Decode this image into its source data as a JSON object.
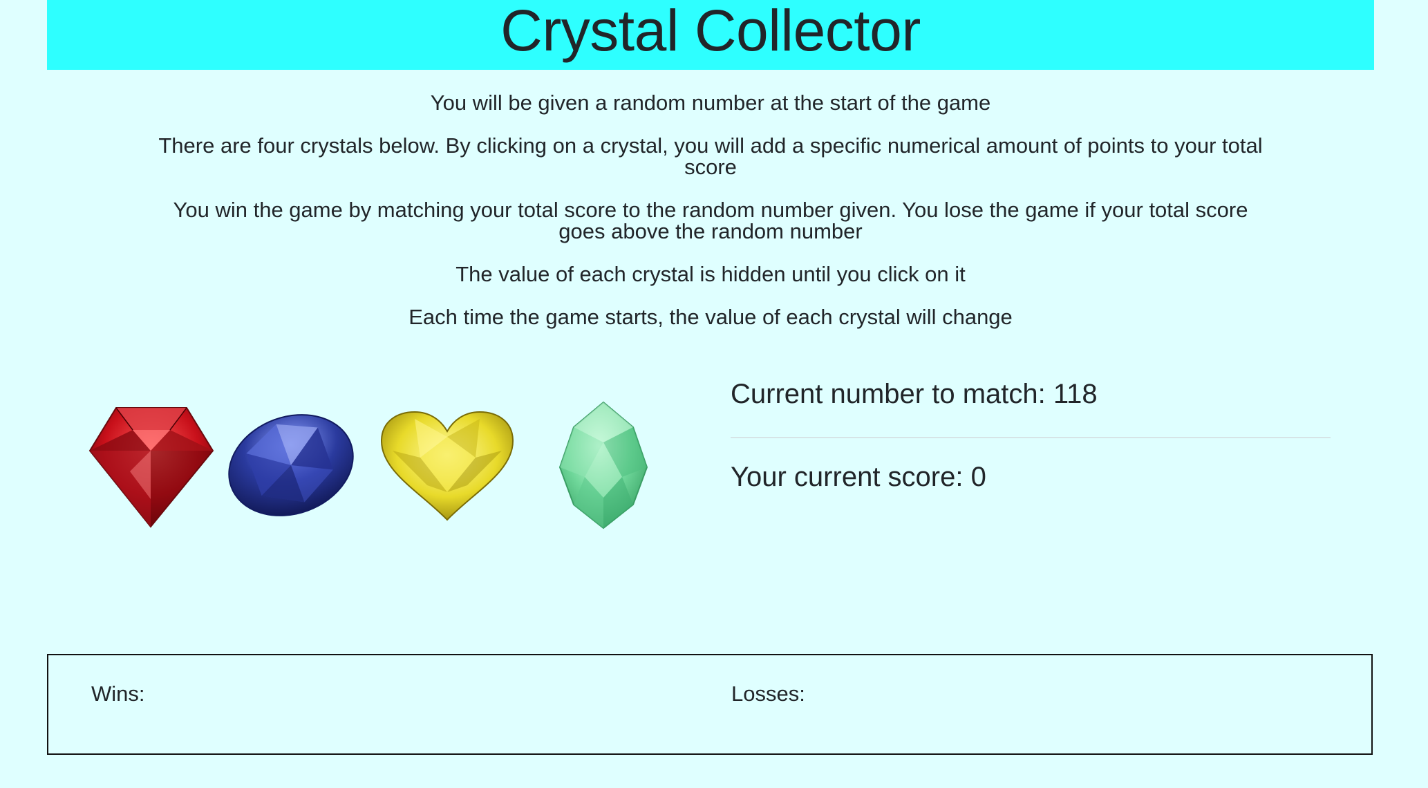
{
  "header": {
    "title": "Crystal Collector"
  },
  "instructions": [
    "You will be given a random number at the start of the game",
    "There are four crystals below. By clicking on a crystal, you will add a specific numerical amount of points to your total score",
    "You win the game by matching your total score to the random number given. You lose the game if your total score goes above the random number",
    "The value of each crystal is hidden until you click on it",
    "Each time the game starts, the value of each crystal will change"
  ],
  "crystals": [
    {
      "name": "red-crystal",
      "color": "#c8101a"
    },
    {
      "name": "blue-crystal",
      "color": "#2a3a9e"
    },
    {
      "name": "yellow-crystal",
      "color": "#e8da2a"
    },
    {
      "name": "green-crystal",
      "color": "#6fd79a"
    }
  ],
  "status": {
    "target_label": "Current number to match:",
    "target_value": "118",
    "score_label": "Your current score:",
    "score_value": "0"
  },
  "scoreboard": {
    "wins_label": "Wins:",
    "wins_value": "",
    "losses_label": "Losses:",
    "losses_value": ""
  },
  "colors": {
    "page_background": "#dfffff",
    "header_background": "#2effff",
    "text": "#212529"
  }
}
